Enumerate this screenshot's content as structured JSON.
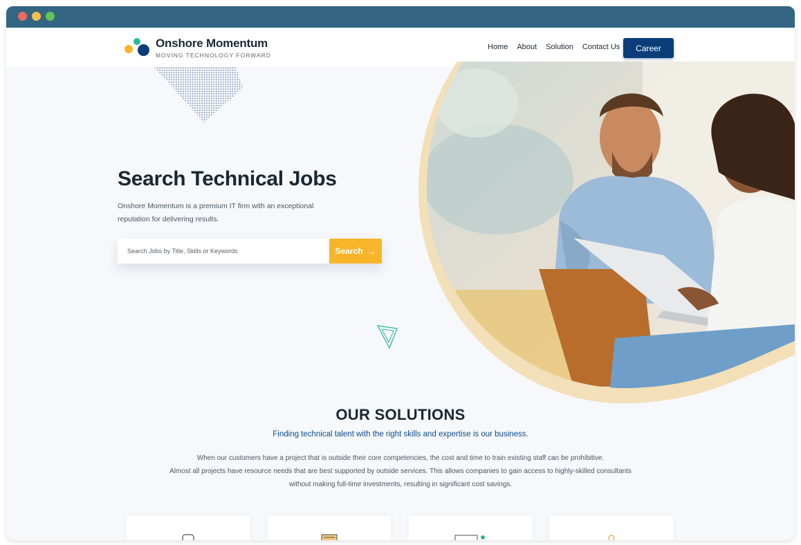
{
  "brand": {
    "name": "Onshore Momentum",
    "tagline": "MOVING TECHNOLOGY FORWARD",
    "colors": {
      "navy": "#0a3d7a",
      "amber": "#f8b52a",
      "teal": "#2bb89a",
      "titlebar": "#346582"
    }
  },
  "nav": {
    "links": [
      "Home",
      "About",
      "Solution",
      "Contact Us"
    ],
    "cta": "Career"
  },
  "hero": {
    "title": "Search Technical Jobs",
    "description": "Onshore Momentum is a premium IT firm with an exceptional reputation for delivering results.",
    "search": {
      "placeholder": "Search Jobs by Title, Skills or Keywords",
      "value": "",
      "button": "Search"
    }
  },
  "solutions": {
    "title": "OUR SOLUTIONS",
    "subtitle": "Finding technical talent with the right skills and expertise is our business.",
    "body": [
      "When our customers have a project that is outside their core competencies, the cost and time to train existing staff can be prohibitive.",
      "Almost all projects have resource needs that are best supported by outside services. This allows companies to gain access to highly-skilled consultants",
      "without making full-time investments, resulting in significant cost savings."
    ]
  },
  "icons": {
    "window": [
      "close-dot",
      "minimize-dot",
      "maximize-dot"
    ],
    "search_button": "arrow-right-icon",
    "cards": [
      "chat-icon",
      "document-icon",
      "monitor-icon",
      "person-icon"
    ]
  }
}
